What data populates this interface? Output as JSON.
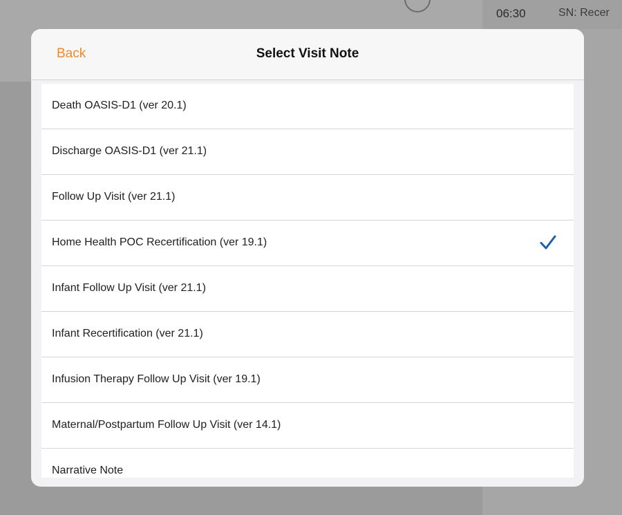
{
  "background": {
    "time": "06:30",
    "entry_label": "SN: Recer"
  },
  "modal": {
    "back_label": "Back",
    "title": "Select Visit Note",
    "items": [
      {
        "label": "Death OASIS-D1 (ver 20.1)",
        "selected": false
      },
      {
        "label": "Discharge OASIS-D1 (ver 21.1)",
        "selected": false
      },
      {
        "label": "Follow Up Visit (ver 21.1)",
        "selected": false
      },
      {
        "label": "Home Health POC Recertification (ver 19.1)",
        "selected": true
      },
      {
        "label": "Infant Follow Up Visit (ver 21.1)",
        "selected": false
      },
      {
        "label": "Infant Recertification (ver 21.1)",
        "selected": false
      },
      {
        "label": "Infusion Therapy Follow Up Visit (ver 19.1)",
        "selected": false
      },
      {
        "label": "Maternal/Postpartum Follow Up Visit (ver 14.1)",
        "selected": false
      },
      {
        "label": "Narrative Note",
        "selected": false
      }
    ]
  },
  "colors": {
    "accent": "#ec8a2c",
    "checkmark": "#1f5fa8"
  },
  "icons": {
    "selected": "checkmark-icon"
  }
}
